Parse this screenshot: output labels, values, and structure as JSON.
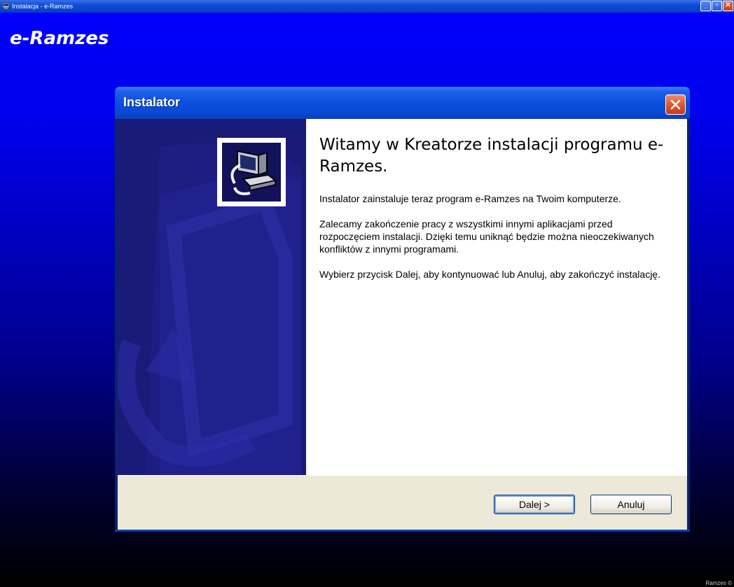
{
  "outer_window": {
    "title": "Instalacja - e-Ramzes",
    "controls": {
      "minimize": "_",
      "restore": "▫",
      "close": "✕"
    }
  },
  "brand": {
    "logo_text": "e-Ramzes"
  },
  "corner_credit": "Ramzes ©",
  "dialog": {
    "title": "Instalator",
    "heading": "Witamy w Kreatorze instalacji programu e-Ramzes.",
    "paragraphs": [
      "Instalator zainstaluje teraz program e-Ramzes na Twoim komputerze.",
      "Zalecamy zakończenie pracy z wszystkimi innymi aplikacjami przed rozpoczęciem instalacji. Dzięki temu uniknąć będzie można nieoczekiwanych konfliktów z innymi programami.",
      "Wybierz przycisk Dalej, aby kontynuować lub Anuluj, aby zakończyć instalację."
    ],
    "buttons": {
      "next": "Dalej >",
      "cancel": "Anuluj"
    }
  },
  "colors": {
    "desktop_top": "#0000ff",
    "desktop_bottom": "#000000",
    "titlebar": "#0a50de",
    "banner": "#1c1c7a",
    "footer": "#ece9d8"
  }
}
